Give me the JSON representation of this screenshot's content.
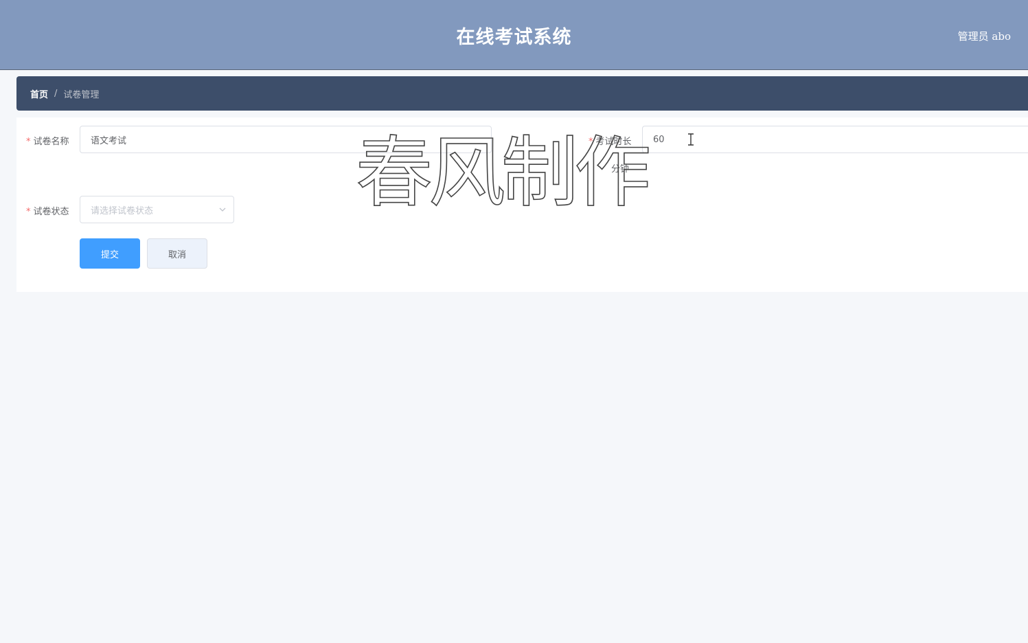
{
  "header": {
    "title": "在线考试系统",
    "user": "管理员 abo"
  },
  "breadcrumb": {
    "home": "首页",
    "separator": "/",
    "current": "试卷管理"
  },
  "form": {
    "name_label": "试卷名称",
    "name_value": "语文考试",
    "duration_label": "考试时长",
    "duration_value": "60",
    "duration_unit": "分钟",
    "status_label": "试卷状态",
    "status_placeholder": "请选择试卷状态",
    "required_mark": "*"
  },
  "actions": {
    "submit_label": "提交",
    "cancel_label": "取消"
  },
  "watermark": {
    "text": "春风制作"
  },
  "colors": {
    "header_bg": "#8299be",
    "breadcrumb_bg": "#3d4e6a",
    "primary": "#409eff",
    "required": "#f56c6c"
  }
}
